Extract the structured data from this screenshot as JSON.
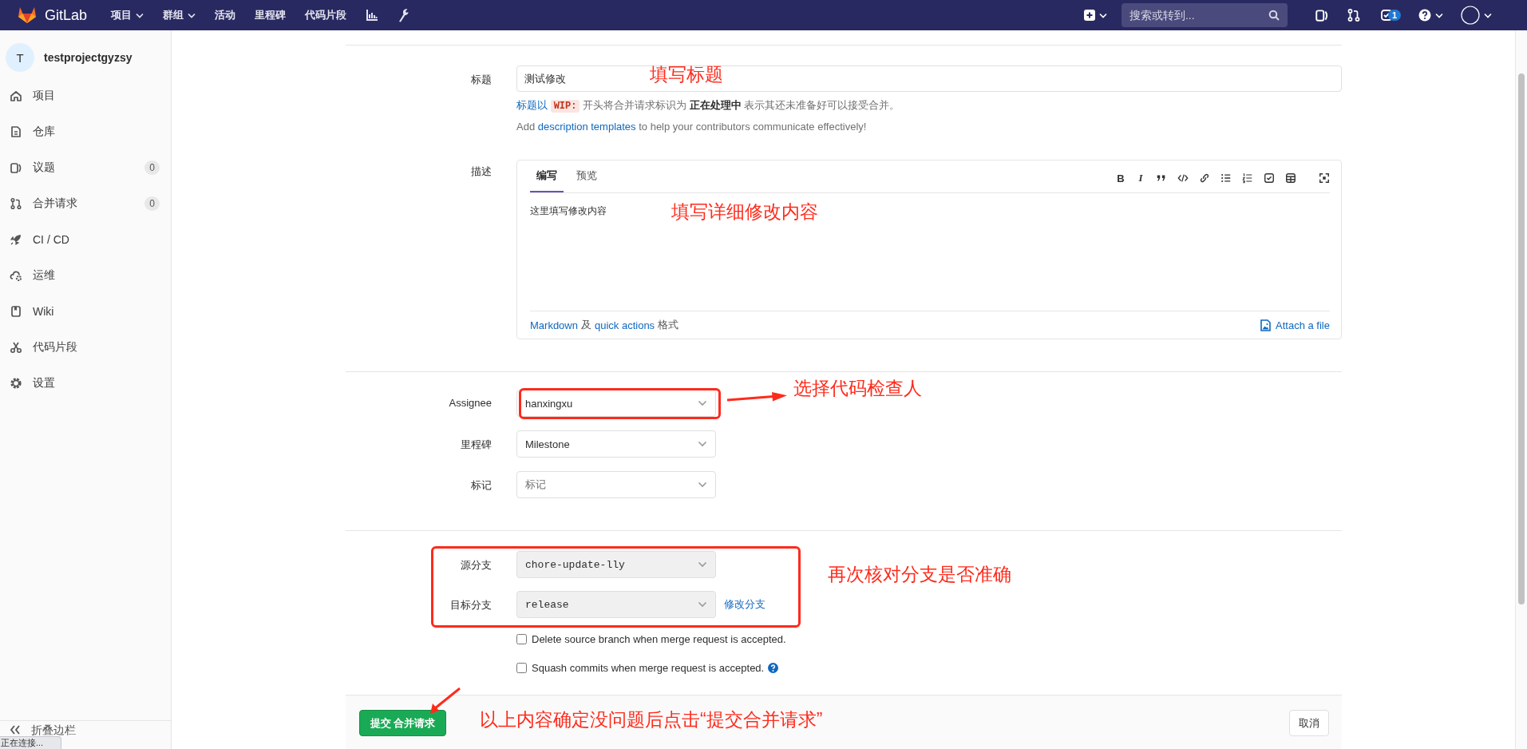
{
  "navbar": {
    "brand": "GitLab",
    "menu": [
      {
        "label": "项目",
        "dropdown": true
      },
      {
        "label": "群组",
        "dropdown": true
      },
      {
        "label": "活动",
        "dropdown": false
      },
      {
        "label": "里程碑",
        "dropdown": false
      },
      {
        "label": "代码片段",
        "dropdown": false
      }
    ],
    "search": {
      "placeholder": "搜索或转到..."
    },
    "todo_count": "1"
  },
  "sidebar": {
    "avatar": "T",
    "project": "testprojectgyzsy",
    "items": [
      {
        "kind": "home",
        "label": "项目"
      },
      {
        "kind": "document",
        "label": "仓库"
      },
      {
        "kind": "issues",
        "label": "议题",
        "count": "0"
      },
      {
        "kind": "merge",
        "label": "合并请求",
        "count": "0"
      },
      {
        "kind": "rocket",
        "label": "CI / CD"
      },
      {
        "kind": "cloud",
        "label": "运维"
      },
      {
        "kind": "book",
        "label": "Wiki"
      },
      {
        "kind": "scissors",
        "label": "代码片段"
      },
      {
        "kind": "gear",
        "label": "设置"
      }
    ],
    "collapse": "折叠边栏"
  },
  "form": {
    "title": {
      "label": "标题",
      "value": "测试修改",
      "annotation": {
        "text": "填写标题",
        "arrow": false
      }
    },
    "wip_hint": {
      "link": "标题以",
      "code": "WIP:",
      "text": "开头将合并请求标识为 **正在处理中** 表示其还未准备好可以接受合并。"
    },
    "templates_hint": {
      "before": "Add",
      "link": "description templates",
      "after": "to help your contributors communicate effectively!"
    },
    "description": {
      "label": "描述",
      "tabs": [
        {
          "label": "编写",
          "selected": true
        },
        {
          "label": "预览",
          "selected": false
        }
      ],
      "toolbar": [
        {
          "kind": "bold",
          "text": "B"
        },
        {
          "kind": "italic",
          "text": "I"
        },
        {
          "kind": "quote"
        },
        {
          "kind": "code"
        },
        {
          "kind": "link"
        },
        {
          "kind": "bullets"
        },
        {
          "kind": "numbers"
        },
        {
          "kind": "task"
        },
        {
          "kind": "table"
        },
        {
          "kind": "fullscreen"
        }
      ],
      "value": "这里填写修改内容",
      "annotation": {
        "text": "填写详细修改内容",
        "arrow": false
      },
      "markdown_link": "Markdown",
      "and": "及",
      "quick_actions_link": "quick actions",
      "format": "格式",
      "attach": "Attach a file"
    },
    "selects": [
      {
        "label": "Assignee",
        "value": "hanxingxu",
        "muted": false,
        "highlighted": true,
        "annotation": {
          "text": "选择代码检查人",
          "arrow": true
        }
      },
      {
        "label": "里程碑",
        "value": "Milestone",
        "muted": false,
        "highlighted": false
      },
      {
        "label": "标记",
        "value": "标记",
        "muted": true,
        "highlighted": false
      }
    ],
    "branches": {
      "highlighted": true,
      "annotation": {
        "text": "再次核对分支是否准确",
        "arrow": false
      },
      "items": [
        {
          "label": "源分支",
          "value": "chore-update-lly",
          "disabled": true
        },
        {
          "label": "目标分支",
          "value": "release",
          "disabled": true,
          "action": "修改分支"
        }
      ]
    },
    "options": [
      {
        "label": "Delete source branch when merge request is accepted.",
        "checked": false,
        "help": false
      },
      {
        "label": "Squash commits when merge request is accepted.",
        "checked": false,
        "help": true
      }
    ],
    "submit": "提交 合并请求",
    "cancel": "取消",
    "footer_annotation": {
      "text": "以上内容确定没问题后点击“提交合并请求”",
      "arrow": true
    }
  },
  "status_tooltip": "正在连接..."
}
